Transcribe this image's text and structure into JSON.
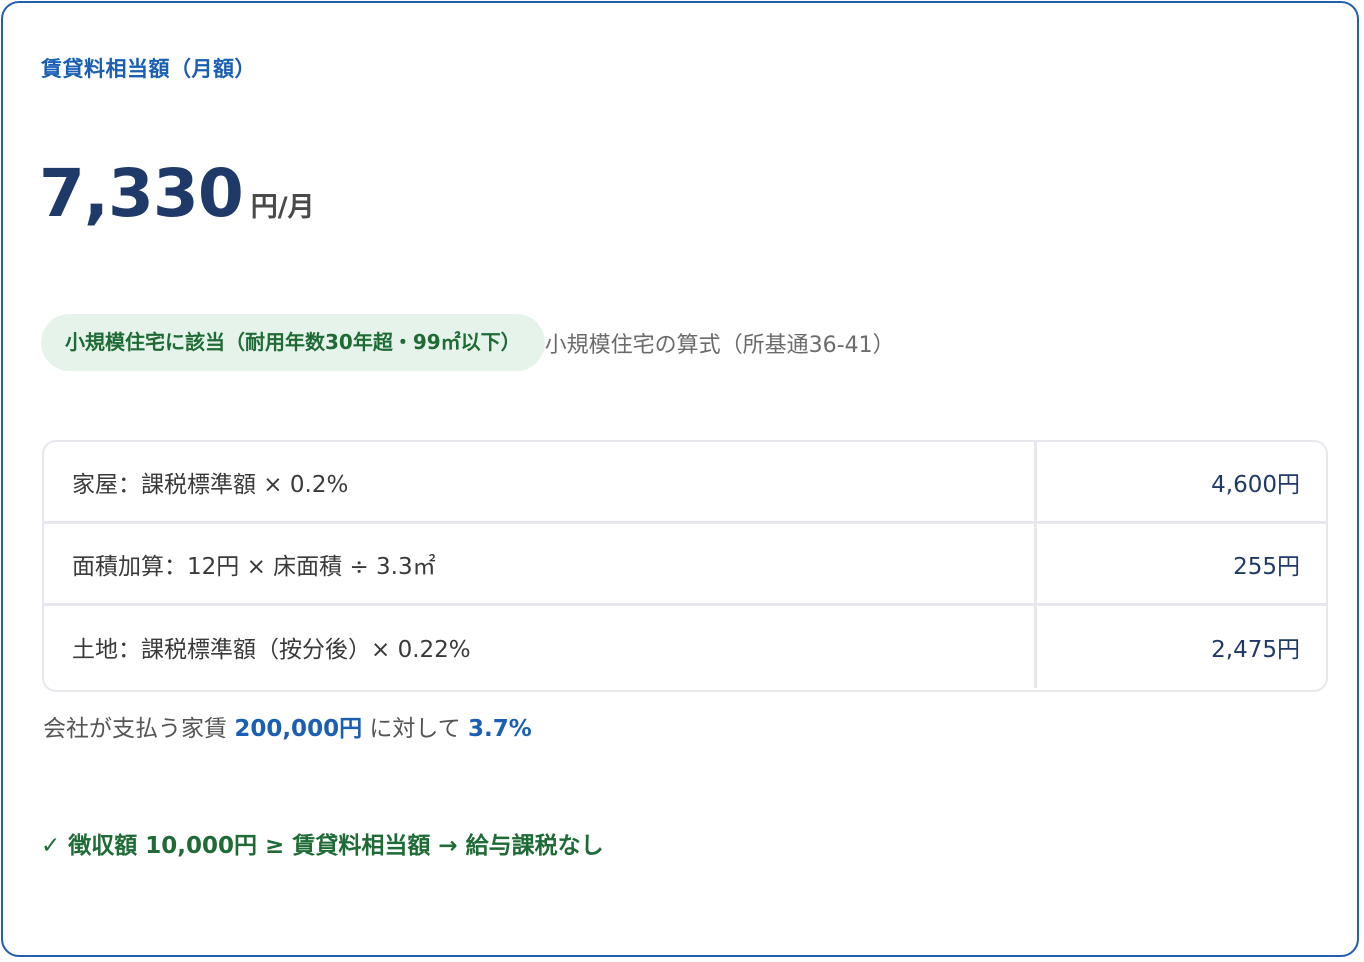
{
  "card": {
    "heading": "賃貸料相当額（月額）",
    "amount": "7,330",
    "unit": "円/月",
    "badge": "小規模住宅に該当（耐用年数30年超・99㎡以下）",
    "formula_label": "小規模住宅の算式（所基通36-41）",
    "rows": [
      {
        "label": "家屋：課税標準額 × 0.2%",
        "value": "4,600円"
      },
      {
        "label": "面積加算：12円 × 床面積 ÷ 3.3㎡",
        "value": "255円"
      },
      {
        "label": "土地：課税標準額（按分後）× 0.22%",
        "value": "2,475円"
      }
    ],
    "ratio": {
      "prefix": "会社が支払う家賃",
      "rent": "200,000円",
      "middle": "に対して",
      "percent": "3.7%"
    },
    "conclusion": "✓ 徴収額 10,000円 ≥ 賃貸料相当額 → 給与課税なし"
  },
  "colors": {
    "border": "#1f5fae",
    "heading": "#1a5fb4",
    "amount": "#1f3a68",
    "badge_bg": "#e6f3ea",
    "badge_text": "#1e6b36",
    "conclusion": "#1e6b36"
  }
}
